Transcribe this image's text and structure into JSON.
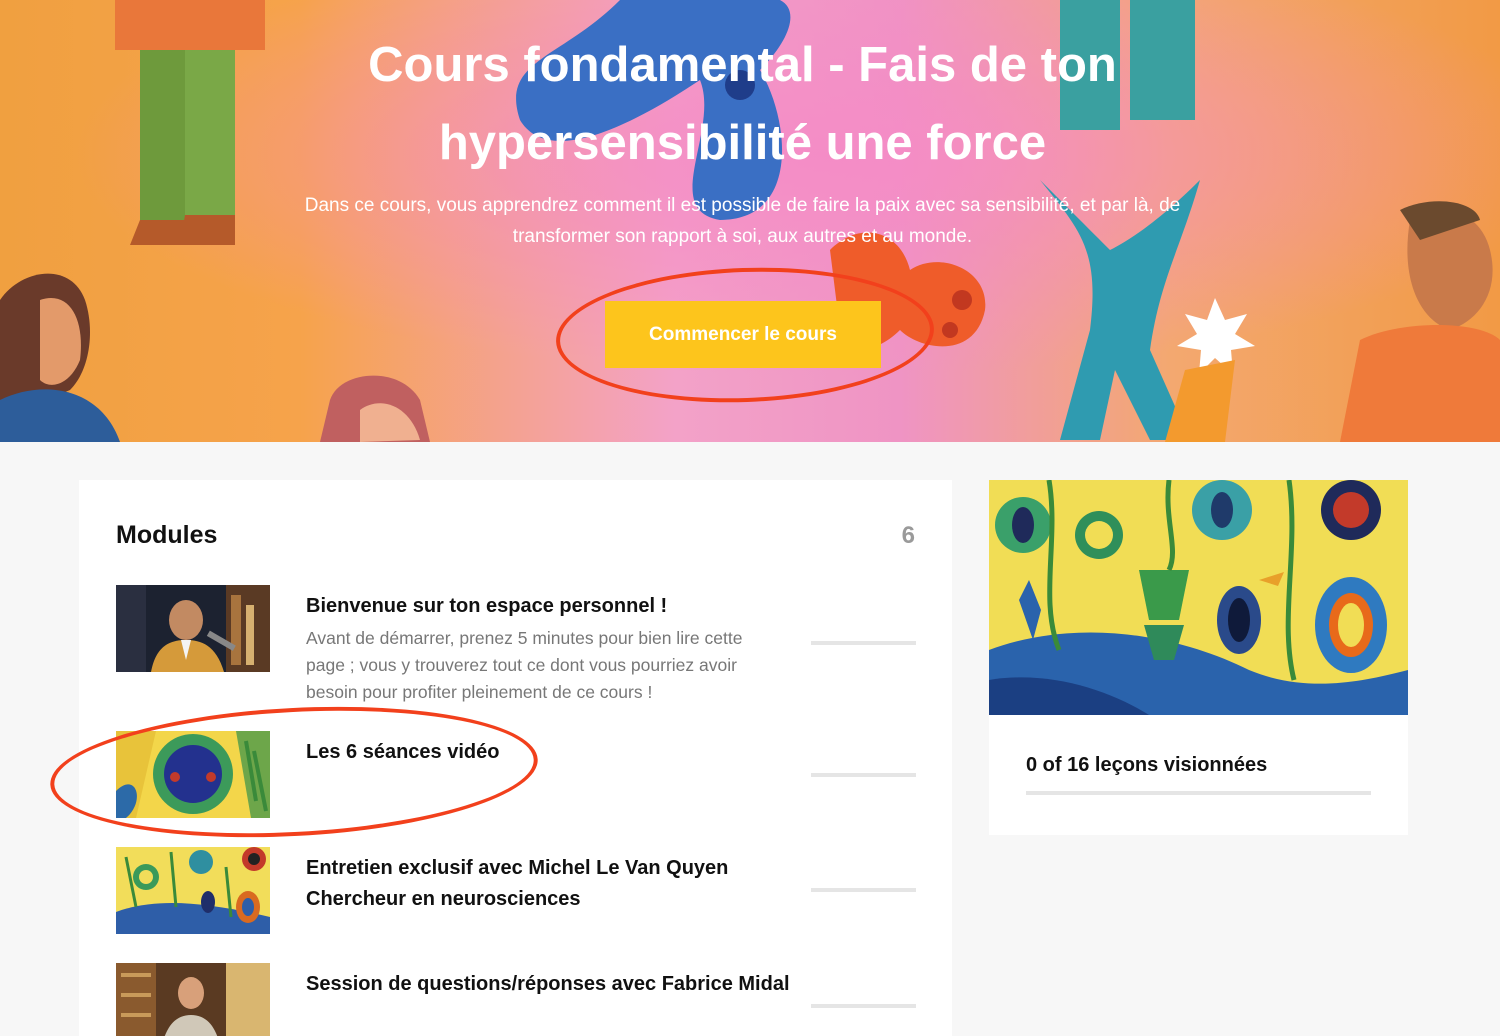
{
  "hero": {
    "title": "Cours fondamental - Fais de ton hypersensibilité une force",
    "subtitle": "Dans ce cours, vous apprendrez comment il est possible de faire la paix avec sa sensibilité, et par là, de transformer son rapport à soi, aux autres et au monde.",
    "cta_label": "Commencer le cours"
  },
  "modules": {
    "heading": "Modules",
    "count": "6",
    "items": [
      {
        "title": "Bienvenue sur ton espace personnel !",
        "description": "Avant de démarrer, prenez 5 minutes pour bien lire cette page ; vous y trouverez tout ce dont vous pourriez avoir besoin pour profiter pleinement de ce cours !",
        "progress": 0
      },
      {
        "title": "Les 6 séances vidéo",
        "description": "",
        "progress": 0
      },
      {
        "title": "Entretien exclusif avec Michel Le Van Quyen Chercheur en neurosciences",
        "description": "",
        "progress": 0
      },
      {
        "title": "Session de questions/réponses avec Fabrice Midal",
        "description": "",
        "progress": 0
      }
    ]
  },
  "progress_card": {
    "label": "0 of 16 leçons visionnées",
    "watched": 0,
    "total": 16
  },
  "colors": {
    "cta": "#fdc51c",
    "annotation": "#f2401c",
    "hero_orange": "#f29a45",
    "hero_pink": "#ef94c4"
  }
}
